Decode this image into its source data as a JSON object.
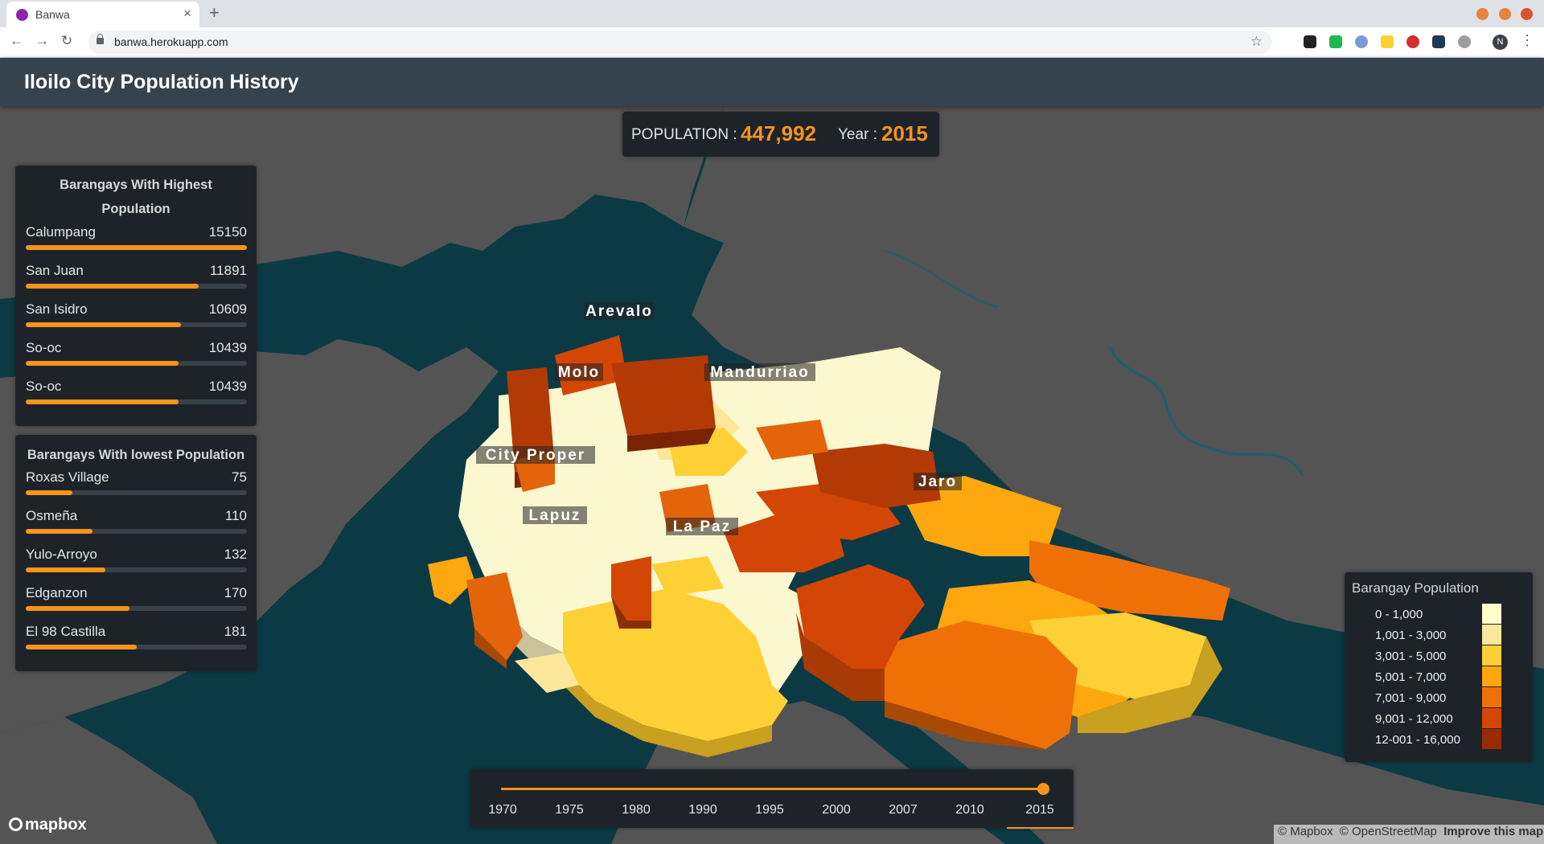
{
  "browser": {
    "tab_title": "Banwa",
    "close_glyph": "×",
    "new_tab_glyph": "+",
    "back_glyph": "←",
    "forward_glyph": "→",
    "reload_glyph": "↻",
    "url": "banwa.herokuapp.com",
    "star_glyph": "☆",
    "profile_initial": "N",
    "menu_glyph": "⋮",
    "window_controls": [
      "#e8833a",
      "#e8833a",
      "#d9542f"
    ],
    "extensions": [
      "paw-extension-icon",
      "shield-extension-icon",
      "privacy-extension-icon",
      "note-extension-icon",
      "adblock-extension-icon",
      "react-extension-icon",
      "download-extension-icon"
    ]
  },
  "header": {
    "title": "Iloilo City Population History"
  },
  "stats": {
    "population_label": "POPULATION :",
    "population_value": "447,992",
    "year_label": "Year :",
    "year_value": "2015"
  },
  "highest": {
    "title_line1": "Barangays With Highest",
    "title_line2": "Population",
    "items": [
      {
        "name": "Calumpang",
        "value": "15150",
        "fill": 1.0
      },
      {
        "name": "San Juan",
        "value": "11891",
        "fill": 0.78
      },
      {
        "name": "San Isidro",
        "value": "10609",
        "fill": 0.7
      },
      {
        "name": "So-oc",
        "value": "10439",
        "fill": 0.69
      },
      {
        "name": "So-oc",
        "value": "10439",
        "fill": 0.69
      }
    ]
  },
  "lowest": {
    "title": "Barangays With lowest Population",
    "items": [
      {
        "name": "Roxas Village",
        "value": "75",
        "fill": 0.21
      },
      {
        "name": "Osmeña",
        "value": "110",
        "fill": 0.3
      },
      {
        "name": "Yulo-Arroyo",
        "value": "132",
        "fill": 0.36
      },
      {
        "name": "Edganzon",
        "value": "170",
        "fill": 0.47
      },
      {
        "name": "El 98 Castilla",
        "value": "181",
        "fill": 0.5
      }
    ]
  },
  "map": {
    "district_labels": [
      {
        "name": "Arevalo"
      },
      {
        "name": "Molo"
      },
      {
        "name": "Mandurriao"
      },
      {
        "name": "City Proper"
      },
      {
        "name": "Jaro"
      },
      {
        "name": "Lapuz"
      },
      {
        "name": "La Paz"
      }
    ]
  },
  "legend": {
    "title": "Barangay Population",
    "items": [
      {
        "label": "0 - 1,000",
        "color": "#ffffcc"
      },
      {
        "label": "1,001 - 3,000",
        "color": "#fce79a"
      },
      {
        "label": "3,001 - 5,000",
        "color": "#fdd036"
      },
      {
        "label": "5,001 - 7,000",
        "color": "#fea70f"
      },
      {
        "label": "7,001 - 9,000",
        "color": "#f07008"
      },
      {
        "label": "9,001 - 12,000",
        "color": "#d44606"
      },
      {
        "label": "12-001 - 16,000",
        "color": "#9a2a04"
      }
    ]
  },
  "slider": {
    "years": [
      "1970",
      "1975",
      "1980",
      "1990",
      "1995",
      "2000",
      "2007",
      "2010",
      "2015"
    ],
    "selected": "2015",
    "position": 1.0
  },
  "footer": {
    "mapbox_logo": "mapbox",
    "attribution_mapbox": "© Mapbox",
    "attribution_osm": "© OpenStreetMap",
    "attribution_improve": "Improve this map"
  }
}
